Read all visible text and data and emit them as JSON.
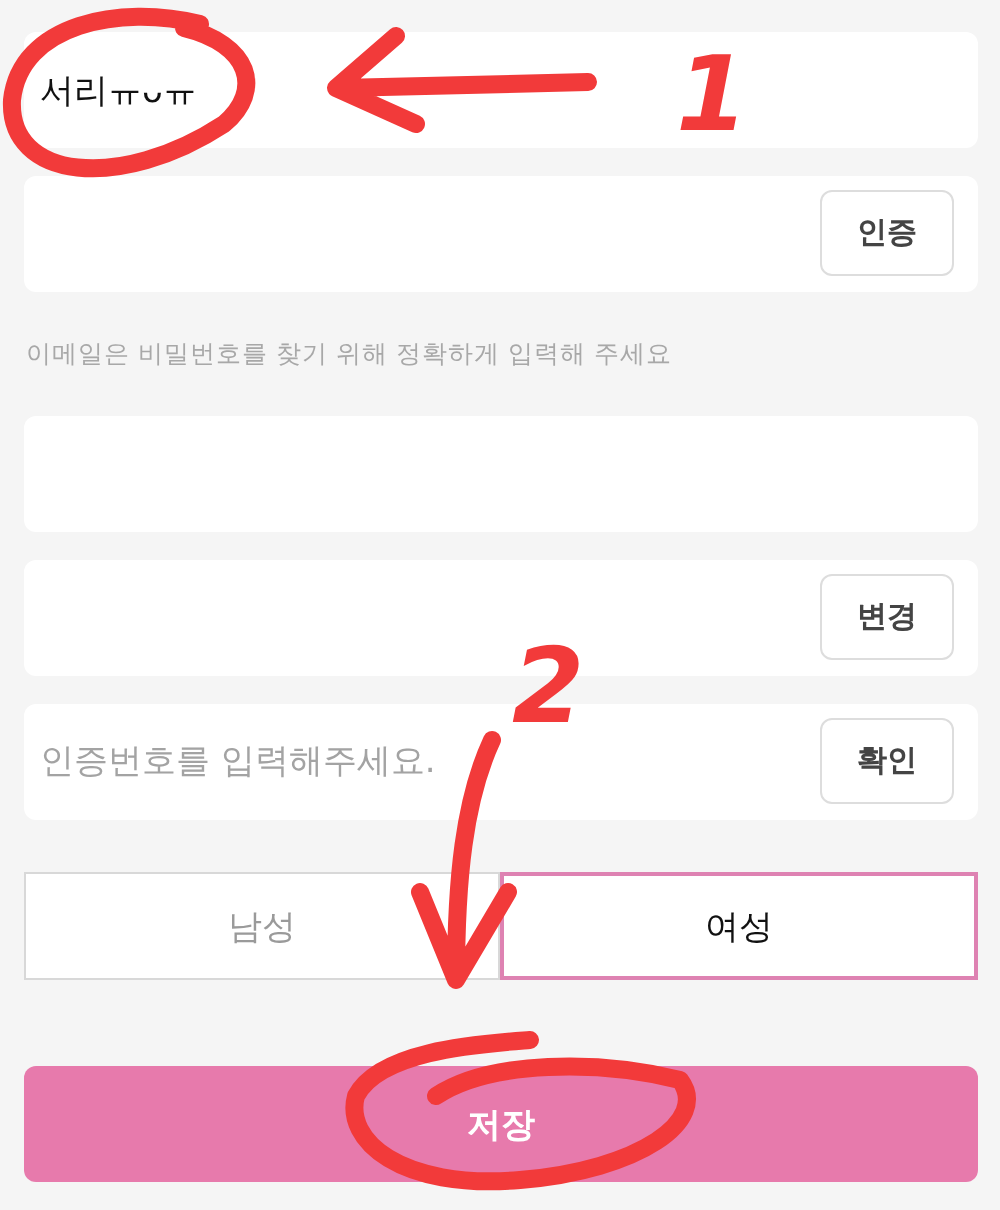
{
  "fields": [
    {
      "kind": "input",
      "value": "서리ㅠᴗㅠ"
    },
    {
      "kind": "input_button",
      "button": "인증"
    },
    {
      "kind": "hint",
      "text": "이메일은 비밀번호를 찾기 위해 정확하게 입력해 주세요"
    },
    {
      "kind": "input"
    },
    {
      "kind": "input_button",
      "button": "변경"
    },
    {
      "kind": "input_button",
      "placeholder": "인증번호를 입력해주세요.",
      "button": "확인"
    }
  ],
  "gender": [
    {
      "label": "남성",
      "selected": false
    },
    {
      "label": "여성",
      "selected": true
    }
  ],
  "save_button": "저장",
  "annotations": [
    {
      "label": "1"
    },
    {
      "label": "2"
    }
  ]
}
